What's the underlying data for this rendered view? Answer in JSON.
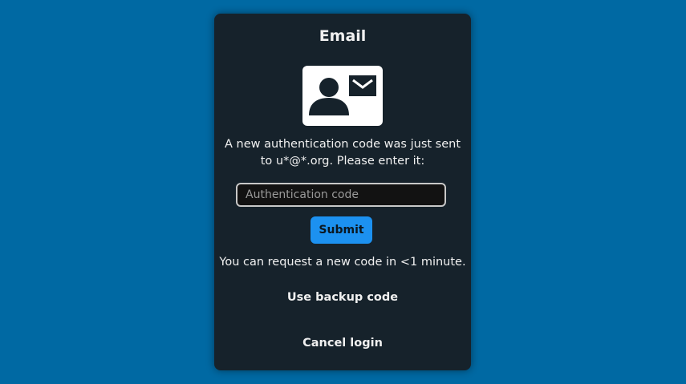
{
  "dialog": {
    "title": "Email",
    "icon": "id-card-email-icon",
    "message": "A new authentication code was just sent to u*@*.org. Please enter it:",
    "code_input": {
      "value": "",
      "placeholder": "Authentication code"
    },
    "submit_label": "Submit",
    "resend_text": "You can request a new code in <1 minute.",
    "backup_label": "Use backup code",
    "cancel_label": "Cancel login"
  },
  "colors": {
    "background": "#0069a3",
    "dialog": "#16222b",
    "accent": "#1c91f0"
  }
}
